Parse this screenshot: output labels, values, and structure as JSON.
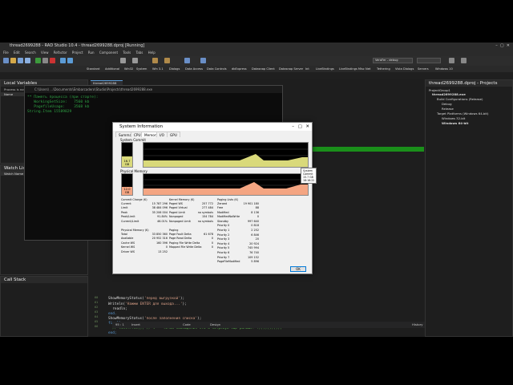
{
  "window": {
    "title": "thread2699288 - RAD Studio 10.4 - thread2699288.dproj [Running]"
  },
  "menu": [
    "File",
    "Edit",
    "Search",
    "View",
    "Refactor",
    "Project",
    "Run",
    "Component",
    "Tools",
    "Tabs",
    "Help"
  ],
  "toolbar": {
    "layout_value": "VeraFer - debug",
    "palette_tabs": [
      "Standard",
      "Additional",
      "Win32",
      "System",
      "Win 3.1",
      "Dialogs",
      "Data Access",
      "Data Controls",
      "dbExpress",
      "Datasnap Client",
      "Datasnap Server",
      "Int",
      "LiveBindings",
      "LiveBindings Misc",
      "Net",
      "Tethering",
      "Vista Dialogs",
      "Servers",
      "Windows 10"
    ]
  },
  "left_panels": {
    "locals_title": "Local Variables",
    "locals_msg": "Process is not accessible",
    "locals_col": "Name",
    "watch_title": "Watch List",
    "watch_col": "Watch Name",
    "callstack_title": "Call Stack"
  },
  "editor": {
    "tab": "thread2699288",
    "console_path": "C:\\Users\\ ...\\Documents\\Embarcadero\\Studio\\Projects\\thread2699288.exe",
    "console_lines": [
      "** Память процесса (при старте):",
      "   WorkingSetSize:   7560 kb",
      "   PagefileUsage:    3568 kb",
      "String.Item 15589829"
    ],
    "line_numbers": [
      "60",
      "61",
      "62",
      "63",
      "64",
      "65",
      "66",
      "67",
      "68",
      "69",
      "70",
      "71",
      "72"
    ],
    "code": {
      "l1_a": "ShowMemoryStatus(",
      "l1_b": "'после заполнения списка'",
      "l1_c": ");",
      "l2": "finally",
      "l3": "  // list.Free(); // <--- точка наблюдения это и потребуй ещё раньше! :)))))))))))",
      "l4": "end;",
      "l5_a": "ShowMemoryStatus(",
      "l5_b": "'перед выгрузкой'",
      "l5_c": ");",
      "l6_a": "Writeln(",
      "l6_b": "'Нажми ENTER для выхода...'",
      "l6_c": ");",
      "l7": "  readln;",
      "l8": "end."
    },
    "status": {
      "pos": "95 : 1",
      "mode": "Insert",
      "modified": "Modified",
      "code_tab": "Code",
      "design_tab": "Design",
      "history_tab": "History"
    }
  },
  "sysinfo": {
    "title": "System Information",
    "tabs": [
      "Summary",
      "CPU",
      "Memory",
      "I/O",
      "GPU"
    ],
    "active_tab": "Memory",
    "system_commit_label": "System Commit",
    "commit_gauge_text": "16.7 GB",
    "commit_fraction": 0.45,
    "physical_memory_label": "Physical Memory",
    "physical_gauge_text": "12.0 GB",
    "physical_fraction": 0.38,
    "tooltip": [
      "System Commit",
      "15.7 GB",
      "18:16:22"
    ],
    "commit_charge": {
      "head": "Commit Charge (K)",
      "rows": [
        [
          "Current",
          "15 787 296"
        ],
        [
          "Limit",
          "38 484 096"
        ],
        [
          "Peak",
          "35 206 004"
        ],
        [
          "Peak/Limit",
          "91.84%"
        ],
        [
          "Current/Limit",
          "46.01%"
        ]
      ]
    },
    "kernel_memory": {
      "head": "Kernel Memory (K)",
      "rows": [
        [
          "Paged WS",
          "257 772"
        ],
        [
          "Paged Virtual",
          "277 484"
        ],
        [
          "Paged Limit",
          "no symbols"
        ],
        [
          "Nonpaged",
          "154 784"
        ],
        [
          "Nonpaged Limit",
          "no symbols"
        ]
      ]
    },
    "paging_lists": {
      "head": "Paging Lists (K)",
      "rows": [
        [
          "Zeroed",
          "19 901 180"
        ],
        [
          "Free",
          "88"
        ],
        [
          "Modified",
          "8 136"
        ],
        [
          "ModifiedNoWrite",
          "0"
        ],
        [
          "Standby",
          "997 640"
        ],
        [
          "Priority 0",
          "0 818"
        ],
        [
          "Priority 1",
          "2 252"
        ],
        [
          "Priority 2",
          "6 846"
        ],
        [
          "Priority 3",
          "20"
        ],
        [
          "Priority 4",
          "20 924"
        ],
        [
          "Priority 5",
          "745 994"
        ],
        [
          "Priority 6",
          "76 740"
        ],
        [
          "Priority 7",
          "109 152"
        ],
        [
          "PageFileModified",
          "5 896"
        ]
      ]
    },
    "physical_memory": {
      "head": "Physical Memory (K)",
      "rows": [
        [
          "Total",
          "33 850 360"
        ],
        [
          "Available",
          "20 952 316"
        ],
        [
          "Cache WS",
          "160 396"
        ],
        [
          "Kernel WS",
          "0"
        ],
        [
          "Driver WS",
          "13 252"
        ]
      ]
    },
    "paging": {
      "head": "Paging",
      "rows": [
        [
          "Page Fault Delta",
          "61 678"
        ],
        [
          "Page Read Delta",
          "0"
        ],
        [
          "Paging File Write Delta",
          "0"
        ],
        [
          "Mapped File Write Delta",
          "0"
        ]
      ]
    },
    "ok": "OK",
    "colors": {
      "commit": "#d9d97a",
      "physical": "#f4a582"
    }
  },
  "project": {
    "title": "thread2699288.dproj - Projects",
    "items": [
      "ProjectGroup1",
      "thread2699288.exe",
      "Build Configurations (Release)",
      "Debug",
      "Release",
      "Target Platforms (Windows 64-bit)",
      "Windows 32-bit",
      "Windows 64-bit"
    ]
  }
}
